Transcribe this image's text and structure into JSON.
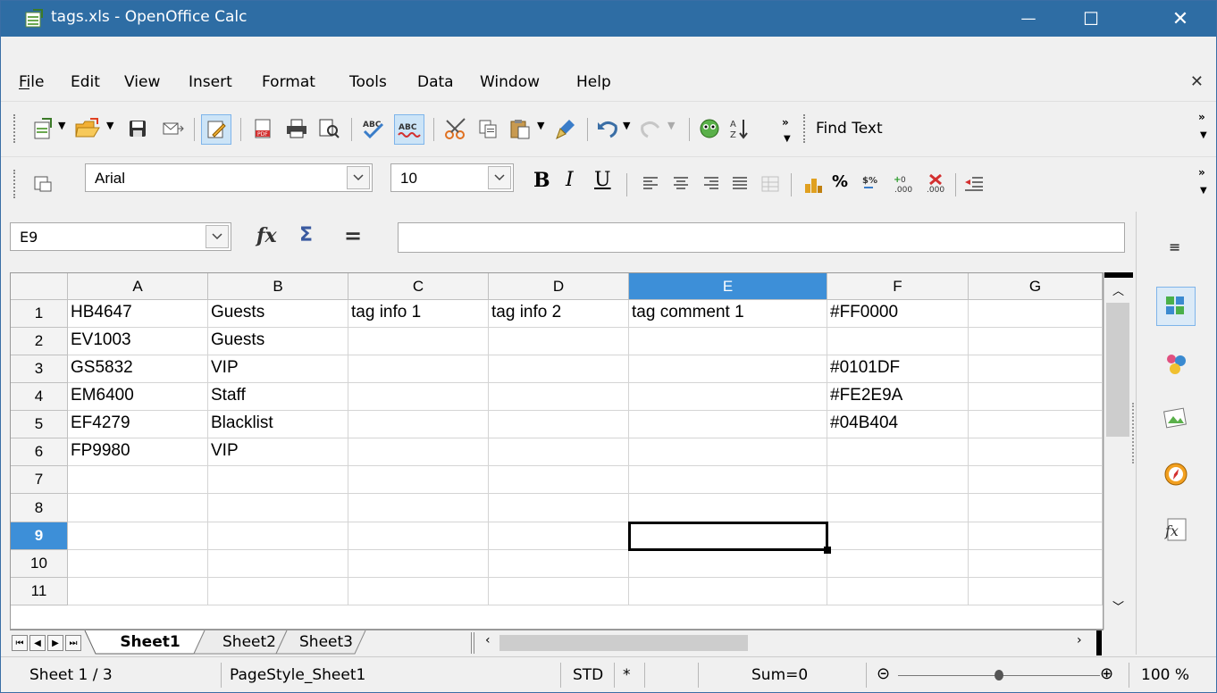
{
  "window": {
    "title": "tags.xls - OpenOffice Calc",
    "minimize": "—",
    "maximize": "☐",
    "close": "✕"
  },
  "menu": {
    "items": [
      "File",
      "Edit",
      "View",
      "Insert",
      "Format",
      "Tools",
      "Data",
      "Window",
      "Help"
    ],
    "close_doc": "✕"
  },
  "toolbar": {
    "find_text": "Find Text"
  },
  "format_toolbar": {
    "font_name": "Arial",
    "font_size": "10",
    "bold": "B",
    "italic": "I",
    "underline": "U",
    "percent": "%"
  },
  "formula_bar": {
    "name_box": "E9",
    "fx": "fx",
    "sum": "Σ",
    "equals": "=",
    "input_value": ""
  },
  "sheet": {
    "columns": [
      "A",
      "B",
      "C",
      "D",
      "E",
      "F",
      "G"
    ],
    "rows": [
      "1",
      "2",
      "3",
      "4",
      "5",
      "6",
      "7",
      "8",
      "9",
      "10",
      "11"
    ],
    "selected_cell": "E9",
    "cells": [
      [
        "HB4647",
        "Guests",
        "tag info 1",
        "tag info 2",
        "tag comment 1",
        "#FF0000",
        ""
      ],
      [
        "EV1003",
        "Guests",
        "",
        "",
        "",
        "",
        ""
      ],
      [
        "GS5832",
        "VIP",
        "",
        "",
        "",
        "#0101DF",
        ""
      ],
      [
        "EM6400",
        "Staff",
        "",
        "",
        "",
        "#FE2E9A",
        ""
      ],
      [
        "EF4279",
        "Blacklist",
        "",
        "",
        "",
        "#04B404",
        ""
      ],
      [
        "FP9980",
        "VIP",
        "",
        "",
        "",
        "",
        ""
      ],
      [
        "",
        "",
        "",
        "",
        "",
        "",
        ""
      ],
      [
        "",
        "",
        "",
        "",
        "",
        "",
        ""
      ],
      [
        "",
        "",
        "",
        "",
        "",
        "",
        ""
      ],
      [
        "",
        "",
        "",
        "",
        "",
        "",
        ""
      ],
      [
        "",
        "",
        "",
        "",
        "",
        "",
        ""
      ]
    ]
  },
  "tabs": [
    "Sheet1",
    "Sheet2",
    "Sheet3"
  ],
  "active_tab": "Sheet1",
  "status": {
    "sheet": "Sheet 1 / 3",
    "page_style": "PageStyle_Sheet1",
    "mode": "STD",
    "modified": "*",
    "sum": "Sum=0",
    "zoom_minus": "⊝",
    "zoom_plus": "⊕",
    "zoom": "100 %"
  },
  "colors": {
    "titlebar": "#2e6da4",
    "selection": "#3d8fd8"
  },
  "icons": [
    "new-doc-icon",
    "open-folder-icon",
    "save-icon",
    "email-icon",
    "edit-mode-icon",
    "pdf-icon",
    "print-icon",
    "page-preview-icon",
    "spellcheck-icon",
    "autospell-icon",
    "cut-icon",
    "copy-icon",
    "paste-icon",
    "clone-format-icon",
    "undo-icon",
    "redo-icon",
    "navigator-icon",
    "sort-icon",
    "properties-icon",
    "styles-icon",
    "gallery-icon",
    "navigator-compass-icon",
    "functions-icon"
  ]
}
